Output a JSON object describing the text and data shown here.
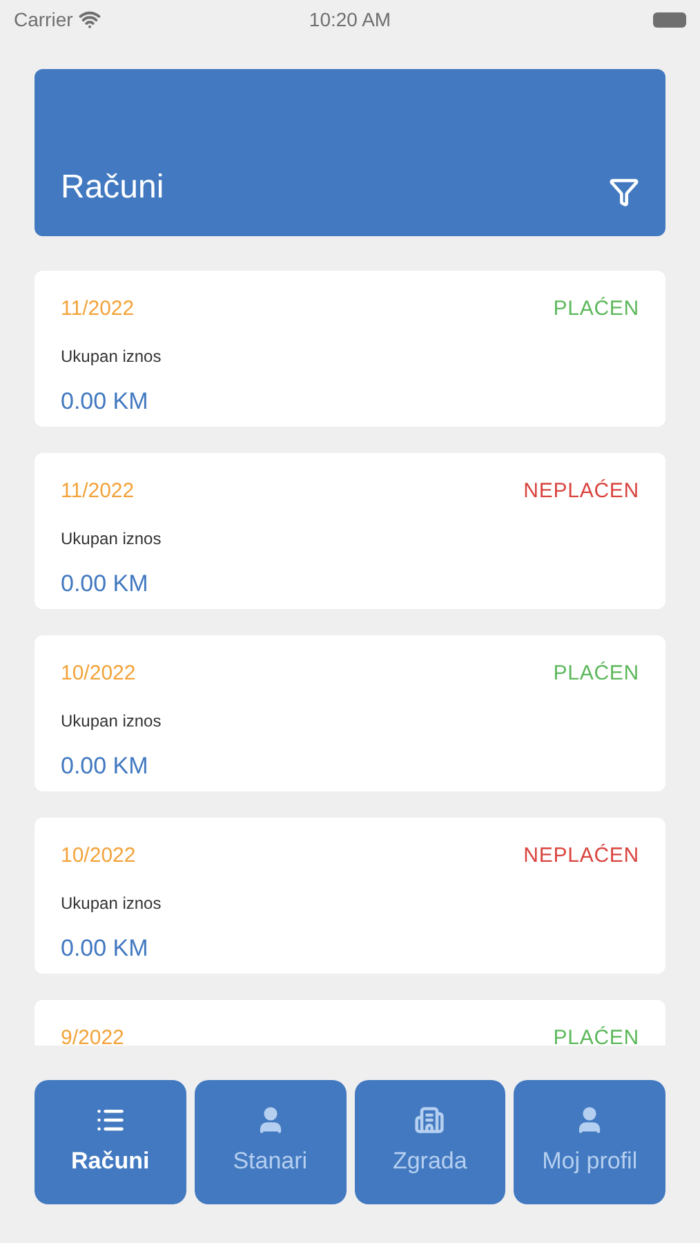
{
  "status_bar": {
    "carrier": "Carrier",
    "time": "10:20 AM"
  },
  "header": {
    "title": "Računi"
  },
  "bills": [
    {
      "period": "11/2022",
      "status": "PLAĆEN",
      "paid": true,
      "label": "Ukupan iznos",
      "amount": "0.00 KM"
    },
    {
      "period": "11/2022",
      "status": "NEPLAĆEN",
      "paid": false,
      "label": "Ukupan iznos",
      "amount": "0.00 KM"
    },
    {
      "period": "10/2022",
      "status": "PLAĆEN",
      "paid": true,
      "label": "Ukupan iznos",
      "amount": "0.00 KM"
    },
    {
      "period": "10/2022",
      "status": "NEPLAĆEN",
      "paid": false,
      "label": "Ukupan iznos",
      "amount": "0.00 KM"
    },
    {
      "period": "9/2022",
      "status": "PLAĆEN",
      "paid": true
    }
  ],
  "tabs": [
    {
      "label": "Računi",
      "kind": "list",
      "selected": true
    },
    {
      "label": "Stanari",
      "kind": "person",
      "selected": false
    },
    {
      "label": "Zgrada",
      "kind": "building",
      "selected": false
    },
    {
      "label": "Moj profil",
      "kind": "person",
      "selected": false
    }
  ]
}
